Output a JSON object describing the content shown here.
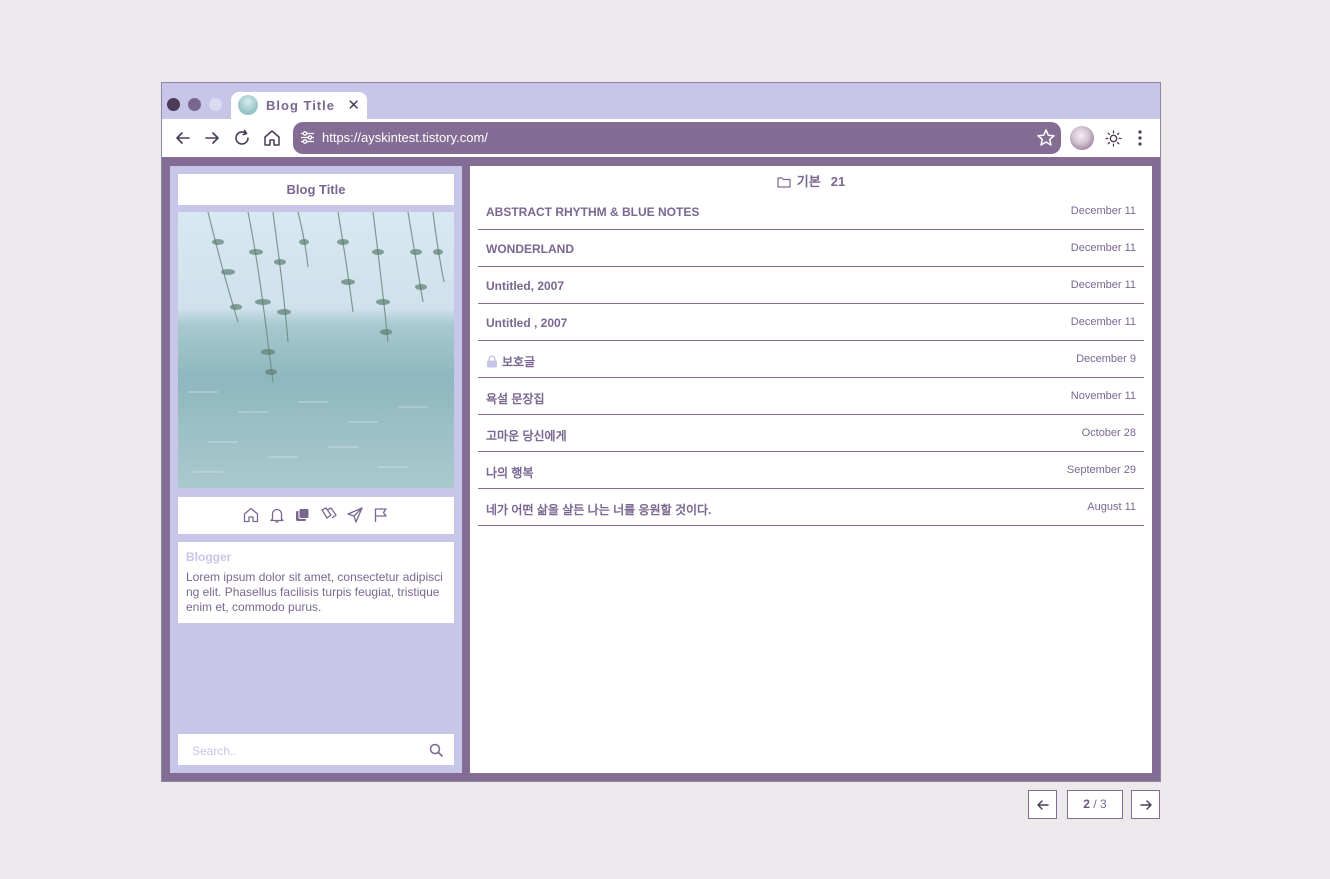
{
  "browser": {
    "tab_title": "Blog Title",
    "tab_close": "✕",
    "url": "https://ayskintest.tistory.com/"
  },
  "sidebar": {
    "blog_title": "Blog Title",
    "icons": [
      "home-icon",
      "bell-icon",
      "folders-icon",
      "tags-icon",
      "send-icon",
      "flag-icon"
    ],
    "blogger_name": "Blogger",
    "blogger_desc": "Lorem ipsum dolor sit amet, consectetur adipiscing elit. Phasellus facilisis turpis feugiat, tristique enim et, commodo purus.",
    "search_placeholder": "Search.."
  },
  "category": {
    "name": "기본",
    "count": "21"
  },
  "posts": [
    {
      "title": "ABSTRACT RHYTHM & BLUE NOTES",
      "date": "December 11",
      "locked": false
    },
    {
      "title": "WONDERLAND",
      "date": "December 11",
      "locked": false
    },
    {
      "title": "Untitled, 2007",
      "date": "December 11",
      "locked": false
    },
    {
      "title": "Untitled , 2007",
      "date": "December 11",
      "locked": false
    },
    {
      "title": "보호글",
      "date": "December 9",
      "locked": true
    },
    {
      "title": "욕설 문장집",
      "date": "November 11",
      "locked": false
    },
    {
      "title": "고마운 당신에게",
      "date": "October 28",
      "locked": false
    },
    {
      "title": "나의 행복",
      "date": "September 29",
      "locked": false
    },
    {
      "title": "네가 어떤 삶을 살든 나는 너를 응원할 것이다.",
      "date": "August 11",
      "locked": false
    }
  ],
  "pagination": {
    "current": "2",
    "separator": " / ",
    "total": "3"
  },
  "colors": {
    "accent": "#836d94",
    "light": "#c7c5e8",
    "text": "#7a6791",
    "background": "#ebe9ec"
  }
}
